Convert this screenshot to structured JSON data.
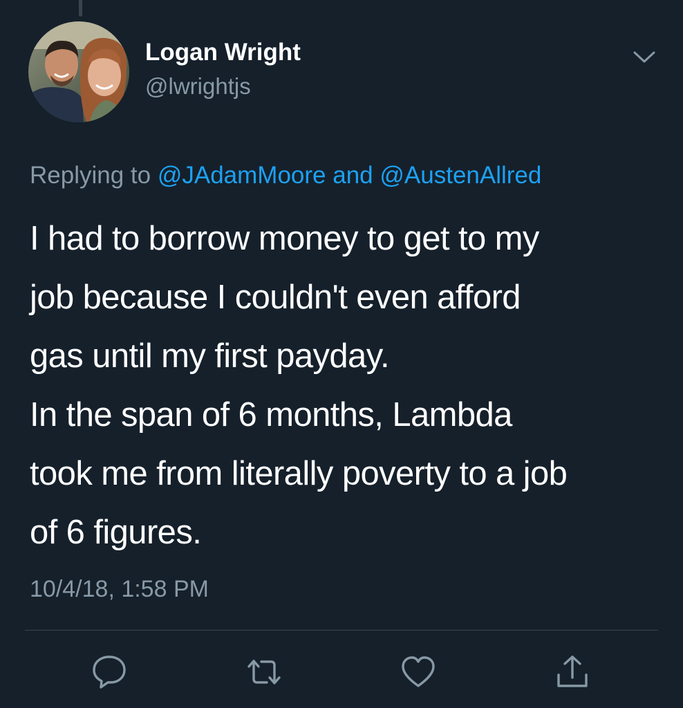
{
  "tweet": {
    "author": {
      "display_name": "Logan Wright",
      "handle": "@lwrightjs",
      "avatar_icon": "profile-photo"
    },
    "menu_icon": "chevron-down-icon",
    "replying": {
      "prefix": "Replying to",
      "mentions": [
        "@JAdamMoore",
        "@AustenAllred"
      ],
      "joiner": "and"
    },
    "text_lines": [
      "I had to borrow money to get to my",
      "job because I couldn't even afford",
      "gas until my first payday.",
      "In the span of 6 months, Lambda",
      "took me from literally poverty to a job",
      "of 6 figures."
    ],
    "timestamp": "10/4/18, 1:58 PM"
  },
  "actions": [
    {
      "name": "reply",
      "icon": "speech-bubble-icon"
    },
    {
      "name": "retweet",
      "icon": "retweet-arrows-icon"
    },
    {
      "name": "like",
      "icon": "heart-icon"
    },
    {
      "name": "share",
      "icon": "share-upload-icon"
    }
  ],
  "colors": {
    "background": "#15202b",
    "text": "#ffffff",
    "secondary": "#8899a6",
    "accent": "#1da1f2",
    "divider": "#38444d"
  }
}
